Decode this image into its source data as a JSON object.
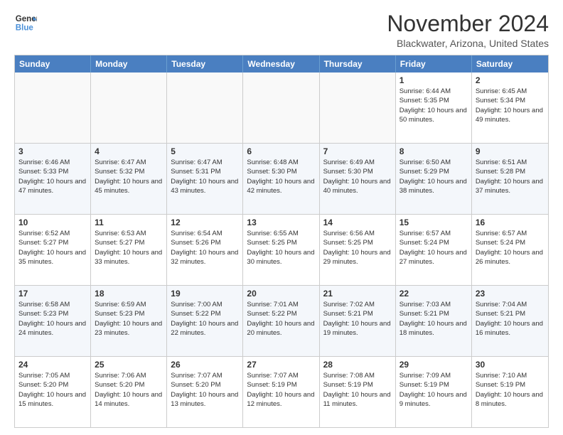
{
  "header": {
    "logo_line1": "General",
    "logo_line2": "Blue",
    "month": "November 2024",
    "location": "Blackwater, Arizona, United States"
  },
  "days_of_week": [
    "Sunday",
    "Monday",
    "Tuesday",
    "Wednesday",
    "Thursday",
    "Friday",
    "Saturday"
  ],
  "rows": [
    [
      {
        "day": "",
        "info": ""
      },
      {
        "day": "",
        "info": ""
      },
      {
        "day": "",
        "info": ""
      },
      {
        "day": "",
        "info": ""
      },
      {
        "day": "",
        "info": ""
      },
      {
        "day": "1",
        "info": "Sunrise: 6:44 AM\nSunset: 5:35 PM\nDaylight: 10 hours and 50 minutes."
      },
      {
        "day": "2",
        "info": "Sunrise: 6:45 AM\nSunset: 5:34 PM\nDaylight: 10 hours and 49 minutes."
      }
    ],
    [
      {
        "day": "3",
        "info": "Sunrise: 6:46 AM\nSunset: 5:33 PM\nDaylight: 10 hours and 47 minutes."
      },
      {
        "day": "4",
        "info": "Sunrise: 6:47 AM\nSunset: 5:32 PM\nDaylight: 10 hours and 45 minutes."
      },
      {
        "day": "5",
        "info": "Sunrise: 6:47 AM\nSunset: 5:31 PM\nDaylight: 10 hours and 43 minutes."
      },
      {
        "day": "6",
        "info": "Sunrise: 6:48 AM\nSunset: 5:30 PM\nDaylight: 10 hours and 42 minutes."
      },
      {
        "day": "7",
        "info": "Sunrise: 6:49 AM\nSunset: 5:30 PM\nDaylight: 10 hours and 40 minutes."
      },
      {
        "day": "8",
        "info": "Sunrise: 6:50 AM\nSunset: 5:29 PM\nDaylight: 10 hours and 38 minutes."
      },
      {
        "day": "9",
        "info": "Sunrise: 6:51 AM\nSunset: 5:28 PM\nDaylight: 10 hours and 37 minutes."
      }
    ],
    [
      {
        "day": "10",
        "info": "Sunrise: 6:52 AM\nSunset: 5:27 PM\nDaylight: 10 hours and 35 minutes."
      },
      {
        "day": "11",
        "info": "Sunrise: 6:53 AM\nSunset: 5:27 PM\nDaylight: 10 hours and 33 minutes."
      },
      {
        "day": "12",
        "info": "Sunrise: 6:54 AM\nSunset: 5:26 PM\nDaylight: 10 hours and 32 minutes."
      },
      {
        "day": "13",
        "info": "Sunrise: 6:55 AM\nSunset: 5:25 PM\nDaylight: 10 hours and 30 minutes."
      },
      {
        "day": "14",
        "info": "Sunrise: 6:56 AM\nSunset: 5:25 PM\nDaylight: 10 hours and 29 minutes."
      },
      {
        "day": "15",
        "info": "Sunrise: 6:57 AM\nSunset: 5:24 PM\nDaylight: 10 hours and 27 minutes."
      },
      {
        "day": "16",
        "info": "Sunrise: 6:57 AM\nSunset: 5:24 PM\nDaylight: 10 hours and 26 minutes."
      }
    ],
    [
      {
        "day": "17",
        "info": "Sunrise: 6:58 AM\nSunset: 5:23 PM\nDaylight: 10 hours and 24 minutes."
      },
      {
        "day": "18",
        "info": "Sunrise: 6:59 AM\nSunset: 5:23 PM\nDaylight: 10 hours and 23 minutes."
      },
      {
        "day": "19",
        "info": "Sunrise: 7:00 AM\nSunset: 5:22 PM\nDaylight: 10 hours and 22 minutes."
      },
      {
        "day": "20",
        "info": "Sunrise: 7:01 AM\nSunset: 5:22 PM\nDaylight: 10 hours and 20 minutes."
      },
      {
        "day": "21",
        "info": "Sunrise: 7:02 AM\nSunset: 5:21 PM\nDaylight: 10 hours and 19 minutes."
      },
      {
        "day": "22",
        "info": "Sunrise: 7:03 AM\nSunset: 5:21 PM\nDaylight: 10 hours and 18 minutes."
      },
      {
        "day": "23",
        "info": "Sunrise: 7:04 AM\nSunset: 5:21 PM\nDaylight: 10 hours and 16 minutes."
      }
    ],
    [
      {
        "day": "24",
        "info": "Sunrise: 7:05 AM\nSunset: 5:20 PM\nDaylight: 10 hours and 15 minutes."
      },
      {
        "day": "25",
        "info": "Sunrise: 7:06 AM\nSunset: 5:20 PM\nDaylight: 10 hours and 14 minutes."
      },
      {
        "day": "26",
        "info": "Sunrise: 7:07 AM\nSunset: 5:20 PM\nDaylight: 10 hours and 13 minutes."
      },
      {
        "day": "27",
        "info": "Sunrise: 7:07 AM\nSunset: 5:19 PM\nDaylight: 10 hours and 12 minutes."
      },
      {
        "day": "28",
        "info": "Sunrise: 7:08 AM\nSunset: 5:19 PM\nDaylight: 10 hours and 11 minutes."
      },
      {
        "day": "29",
        "info": "Sunrise: 7:09 AM\nSunset: 5:19 PM\nDaylight: 10 hours and 9 minutes."
      },
      {
        "day": "30",
        "info": "Sunrise: 7:10 AM\nSunset: 5:19 PM\nDaylight: 10 hours and 8 minutes."
      }
    ]
  ]
}
